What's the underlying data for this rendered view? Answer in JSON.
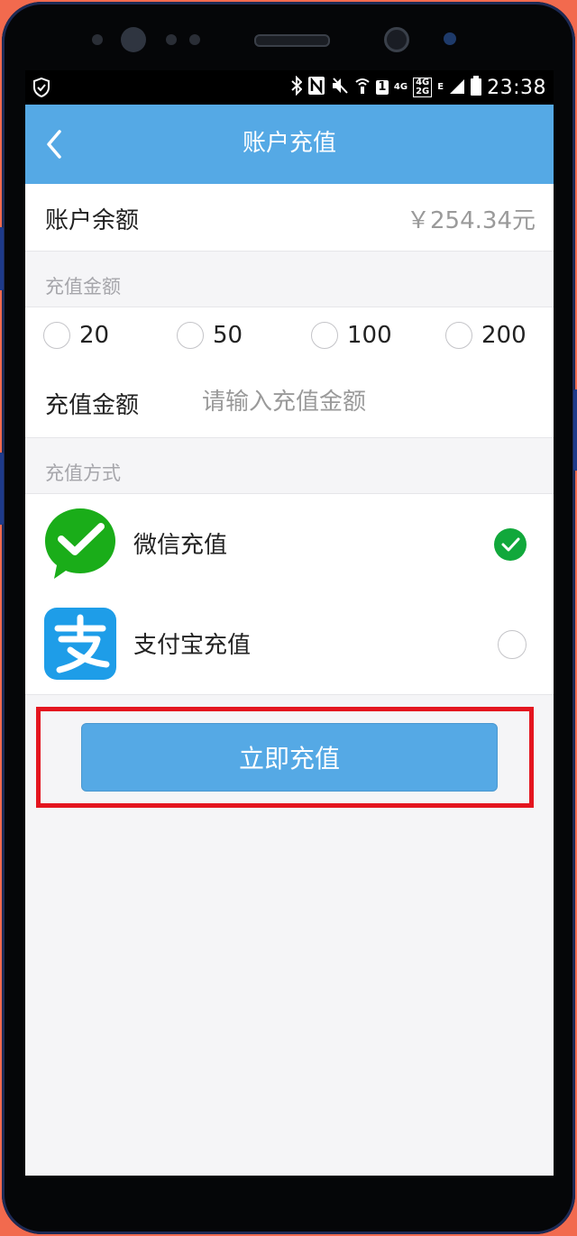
{
  "status_bar": {
    "time": "23:38",
    "sim_badge": "1",
    "net_4g": "4G",
    "net_4g_small": "4G",
    "net_2g_small": "2G",
    "net_e": "E"
  },
  "nav": {
    "title": "账户充值"
  },
  "balance": {
    "label": "账户余额",
    "value": "￥254.34元"
  },
  "amount_section": {
    "header": "充值金额",
    "options": [
      "20",
      "50",
      "100",
      "200"
    ],
    "input_label": "充值金额",
    "input_placeholder": "请输入充值金额",
    "input_value": ""
  },
  "payment_section": {
    "header": "充值方式",
    "methods": [
      {
        "label": "微信充值",
        "selected": true,
        "icon": "wechat-icon"
      },
      {
        "label": "支付宝充值",
        "selected": false,
        "icon": "alipay-icon"
      }
    ]
  },
  "submit": {
    "label": "立即充值"
  },
  "colors": {
    "nav_blue": "#55A9E5",
    "wechat_green": "#1AAD19",
    "check_green": "#11A83B",
    "alipay_blue": "#1E9DE8",
    "highlight_red": "#E4151F",
    "background_orange": "#F26A4E"
  }
}
